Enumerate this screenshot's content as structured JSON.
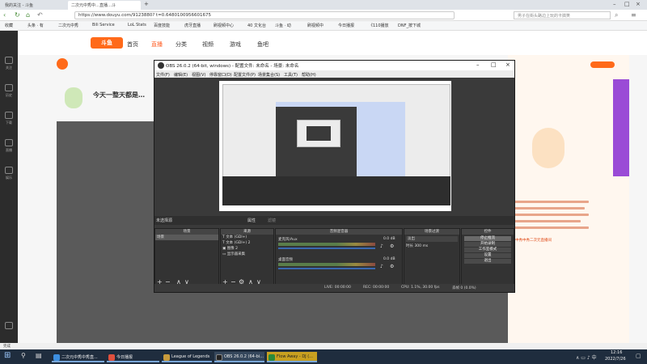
{
  "browser": {
    "tabs": [
      "我的关注 - 斗鱼",
      "二次元中秀中…直播…斗"
    ],
    "url": "https://www.douyu.com/9123880? t=0.6480100956601675",
    "search_placeholder": "男子在街头路边上玩的卡搞笑",
    "bookmarks": [
      "收藏",
      "头条 · 有",
      "二次元中秀",
      "Bili Service",
      "LoL Stats",
      "百度技能",
      "虎牙直播",
      "刷视频中心",
      "40 文化台",
      "斗鱼 · 动",
      "刷视频中",
      "今日播报",
      "《110播放",
      "DNF_按下城"
    ]
  },
  "site": {
    "logo": "斗鱼",
    "nav": [
      "首页",
      "直播",
      "分类",
      "视频",
      "游戏",
      "鱼吧"
    ],
    "room_title": "今天一整天都是…",
    "right_promo": "文化中秀中秀二次元直播间",
    "left_rail": [
      "关注",
      "历史",
      "下载",
      "直播",
      "娱乐",
      "设置"
    ]
  },
  "obs": {
    "title": "OBS 26.0.2 (64-bit, windows) - 配置文件: 未命名 - 场景: 未命名",
    "menu": [
      "文件(F)",
      "编辑(E)",
      "视图(V)",
      "停靠窗口(D)",
      "配置文件(P)",
      "场景集合(S)",
      "工具(T)",
      "帮助(H)"
    ],
    "source_bar": {
      "label": "未选择源",
      "properties": "属性",
      "filters": "滤镜"
    },
    "scenes": {
      "header": "场景",
      "items": [
        "场景"
      ]
    },
    "sources": {
      "header": "来源",
      "items": [
        "文本 (GDI+)",
        "文本 (GDI+) 2",
        "图像 2",
        "显示器采集"
      ]
    },
    "mixer": {
      "header": "音频混音器",
      "tracks": [
        {
          "name": "麦克风/Aux",
          "db": "0.0 dB"
        },
        {
          "name": "桌面音频",
          "db": "0.0 dB"
        }
      ]
    },
    "transitions": {
      "header": "场景过渡",
      "type": "淡出",
      "duration_label": "时长",
      "duration": "300 ms"
    },
    "controls": {
      "header": "控件",
      "buttons": [
        "停止推流",
        "开始录制",
        "工作室模式",
        "设置",
        "退出"
      ]
    },
    "status": {
      "dropped": "丢帧 0 (0.0%)",
      "live": "LIVE: 00:00:00",
      "rec": "REC: 00:00:00",
      "cpu": "CPU: 1.1%, 30.00 fps",
      "kbps": "kb/s: 0"
    }
  },
  "winstatus": "完成",
  "taskbar": {
    "items": [
      "二次元中秀中秀直...",
      "今日播报",
      "League of Legends",
      "OBS 26.0.2 (64-bi...",
      "Flow Away - DJ (..."
    ],
    "time": "12:16",
    "date": "2022/7/26"
  }
}
